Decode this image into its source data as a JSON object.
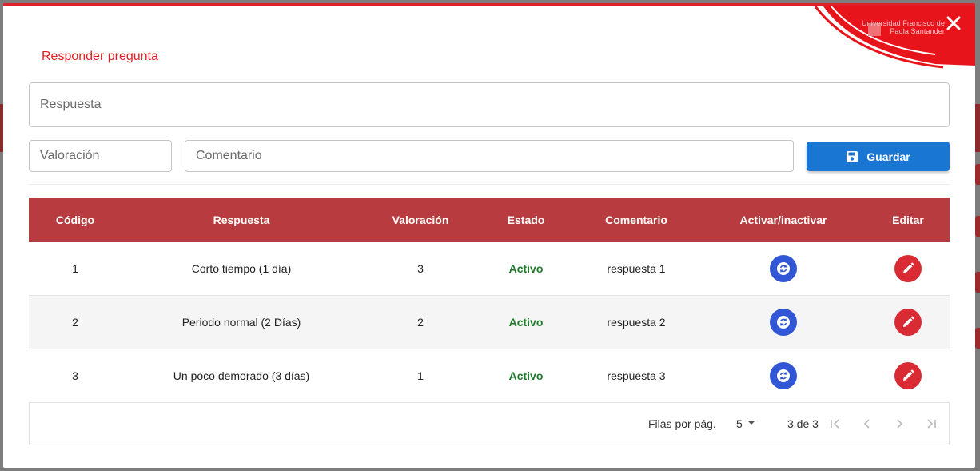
{
  "modal": {
    "title": "Responder pregunta",
    "logo_text": "Universidad Francisco de Paula Santander",
    "close_icon": "close-icon"
  },
  "form": {
    "respuesta_label": "Respuesta",
    "valoracion_label": "Valoración",
    "comentario_label": "Comentario",
    "save_label": "Guardar",
    "save_icon": "save-icon"
  },
  "table": {
    "headers": [
      "Código",
      "Respuesta",
      "Valoración",
      "Estado",
      "Comentario",
      "Activar/inactivar",
      "Editar"
    ],
    "rows": [
      {
        "codigo": "1",
        "respuesta": "Corto tiempo (1 día)",
        "valoracion": "3",
        "estado": "Activo",
        "comentario": "respuesta 1"
      },
      {
        "codigo": "2",
        "respuesta": "Periodo normal (2 Días)",
        "valoracion": "2",
        "estado": "Activo",
        "comentario": "respuesta 2"
      },
      {
        "codigo": "3",
        "respuesta": "Un poco demorado (3 días)",
        "valoracion": "1",
        "estado": "Activo",
        "comentario": "respuesta 3"
      }
    ]
  },
  "pagination": {
    "rows_per_page_label": "Filas por pág.",
    "rows_per_page": "5",
    "range": "3 de 3"
  },
  "colors": {
    "accent_red": "#e31d24",
    "header_red": "#b83c3f",
    "primary_blue": "#1976d2",
    "toggle_blue": "#3157d6",
    "edit_red": "#d92b33",
    "active_green": "#1f7a2a"
  }
}
